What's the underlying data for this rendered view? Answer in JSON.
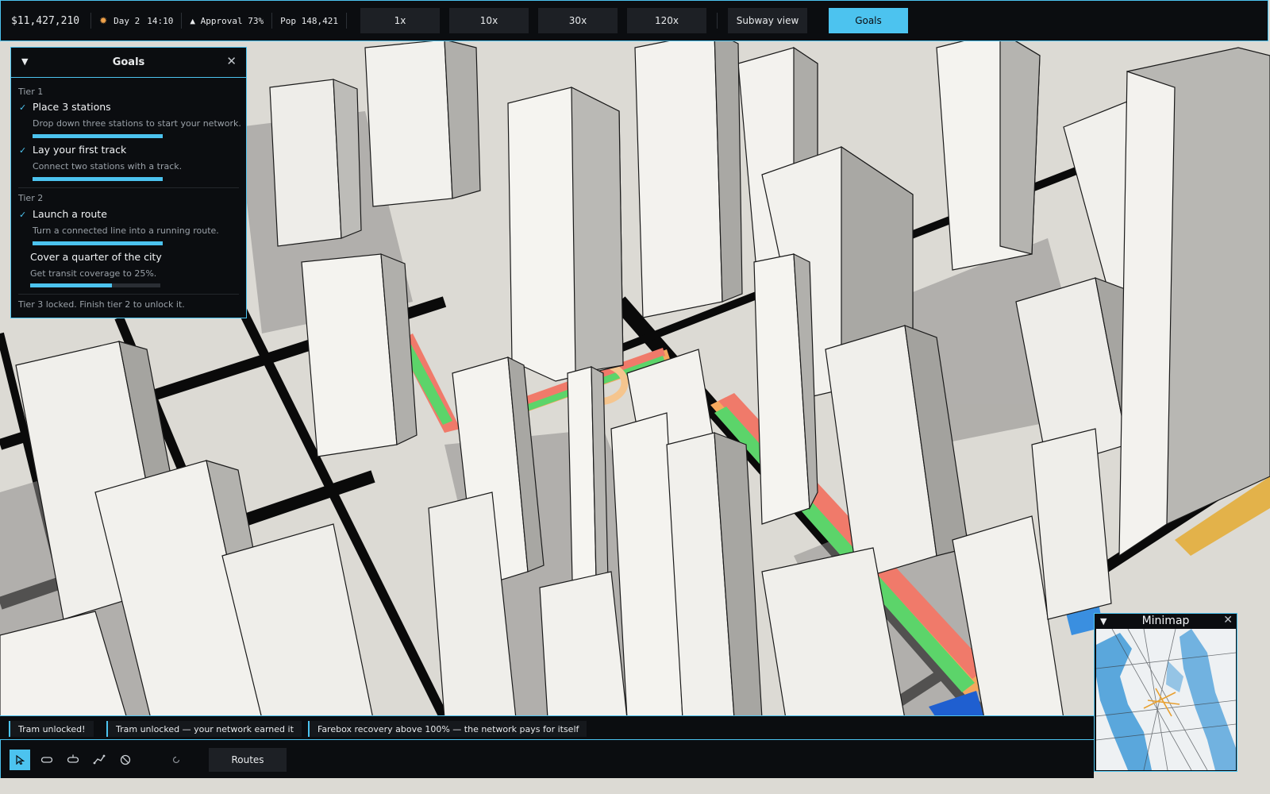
{
  "hud": {
    "money": "$11,427,210",
    "sun_icon": "sun-icon",
    "day": "Day 2",
    "time": "14:10",
    "approval": "▲ Approval 73%",
    "population": "Pop 148,421",
    "speed_buttons": [
      "1x",
      "10x",
      "30x",
      "120x"
    ],
    "subway_view": "Subway view",
    "goals": "Goals"
  },
  "goals_panel": {
    "title": "Goals",
    "collapse_icon": "▼",
    "close_icon": "✕",
    "tiers": [
      {
        "label": "Tier 1",
        "goals": [
          {
            "name": "Place 3 stations",
            "desc": "Drop down three stations to start your network.",
            "done": true,
            "progress": 1.0
          },
          {
            "name": "Lay your first track",
            "desc": "Connect two stations with a track.",
            "done": true,
            "progress": 1.0
          }
        ]
      },
      {
        "label": "Tier 2",
        "goals": [
          {
            "name": "Launch a route",
            "desc": "Turn a connected line into a running route.",
            "done": true,
            "progress": 1.0
          },
          {
            "name": "Cover a quarter of the city",
            "desc": "Get transit coverage to 25%.",
            "done": false,
            "progress": 0.63
          }
        ]
      }
    ],
    "locked_note": "Tier 3 locked. Finish tier 2 to unlock it."
  },
  "notifications": [
    "Tram unlocked!",
    "Tram unlocked — your network earned it",
    "Farebox recovery above 100% — the network pays for itself"
  ],
  "toolbar": {
    "tools": [
      "select-icon",
      "station-icon",
      "tram-stop-icon",
      "track-icon",
      "demolish-icon"
    ],
    "undo_icon": "undo-icon",
    "routes": "Routes"
  },
  "minimap": {
    "title": "Minimap",
    "collapse_icon": "▼",
    "close_icon": "✕"
  },
  "colors": {
    "accent": "#4cc3ef",
    "panel_bg": "#0b0d10",
    "route_red": "#f07a6a",
    "route_green": "#5cd46a",
    "route_orange": "#f5a85e",
    "water": "#5aa7dc"
  }
}
